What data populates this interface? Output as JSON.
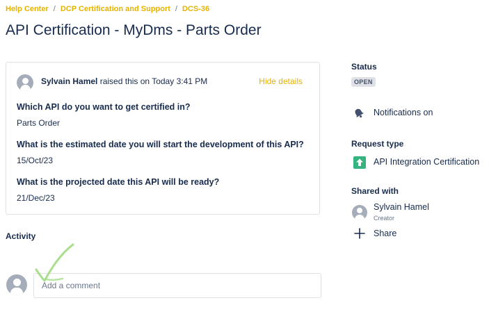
{
  "breadcrumb": {
    "items": [
      "Help Center",
      "DCP Certification and Support",
      "DCS-36"
    ],
    "separator": "/"
  },
  "page": {
    "title": "API Certification - MyDms - Parts Order"
  },
  "request": {
    "reporter": "Sylvain Hamel",
    "raised_text": "raised this on Today 3:41 PM",
    "hide_details_label": "Hide details",
    "fields": [
      {
        "question": "Which API do you want to get certified in?",
        "answer": "Parts Order"
      },
      {
        "question": "What is the estimated date you will start the development of this API?",
        "answer": "15/Oct/23"
      },
      {
        "question": "What is the projected date this API will be ready?",
        "answer": "21/Dec/23"
      }
    ]
  },
  "activity": {
    "label": "Activity",
    "comment_placeholder": "Add a comment"
  },
  "sidebar": {
    "status_label": "Status",
    "status_value": "OPEN",
    "notifications_label": "Notifications on",
    "request_type_label": "Request type",
    "request_type_value": "API Integration Certification",
    "shared_with_label": "Shared with",
    "shared_user_name": "Sylvain Hamel",
    "shared_user_role": "Creator",
    "share_label": "Share"
  },
  "colors": {
    "link": "#e5b300",
    "text": "#172b4d",
    "border": "#dfe1e6",
    "request_type_icon": "#36b37e",
    "annotation_check": "#9bd87a"
  },
  "icons": [
    "user-avatar-icon",
    "bell-icon",
    "arrow-up-icon",
    "plus-icon",
    "checkmark-icon"
  ]
}
